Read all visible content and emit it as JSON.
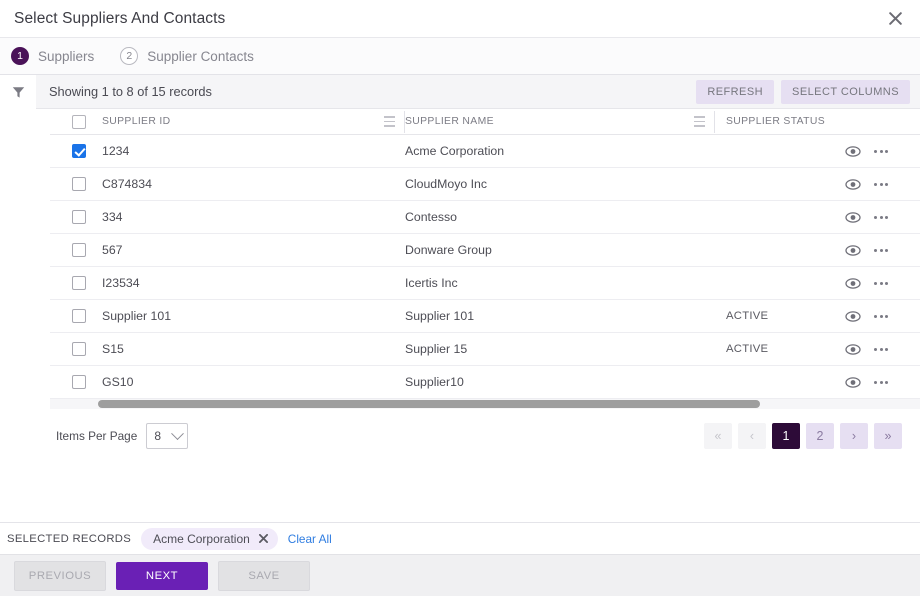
{
  "window": {
    "title": "Select Suppliers And Contacts",
    "close_icon": "close-icon"
  },
  "steps": [
    {
      "num": "1",
      "label": "Suppliers",
      "state": "active"
    },
    {
      "num": "2",
      "label": "Supplier Contacts",
      "state": "inactive"
    }
  ],
  "toolbar": {
    "filter_icon": "filter-icon",
    "showing_text": "Showing 1 to 8 of 15 records",
    "refresh_label": "REFRESH",
    "select_columns_label": "SELECT COLUMNS"
  },
  "table": {
    "columns": [
      "SUPPLIER ID",
      "SUPPLIER NAME",
      "SUPPLIER STATUS"
    ],
    "rows": [
      {
        "checked": true,
        "id": "1234",
        "name": "Acme Corporation",
        "status": ""
      },
      {
        "checked": false,
        "id": "C874834",
        "name": "CloudMoyo Inc",
        "status": ""
      },
      {
        "checked": false,
        "id": "334",
        "name": "Contesso",
        "status": ""
      },
      {
        "checked": false,
        "id": "567",
        "name": "Donware Group",
        "status": ""
      },
      {
        "checked": false,
        "id": "I23534",
        "name": "Icertis Inc",
        "status": ""
      },
      {
        "checked": false,
        "id": "Supplier 101",
        "name": "Supplier 101",
        "status": "ACTIVE"
      },
      {
        "checked": false,
        "id": "S15",
        "name": "Supplier 15",
        "status": "ACTIVE"
      },
      {
        "checked": false,
        "id": "GS10",
        "name": "Supplier10",
        "status": ""
      }
    ],
    "row_view_icon": "eye-icon",
    "row_more_icon": "more-options-icon"
  },
  "pagination": {
    "items_per_page_label": "Items Per Page",
    "items_per_page_value": "8",
    "first_label": "«",
    "prev_label": "‹",
    "next_label": "›",
    "last_label": "»",
    "pages": [
      "1",
      "2"
    ],
    "current_page": "1"
  },
  "selected_records": {
    "label": "SELECTED RECORDS",
    "chips": [
      "Acme Corporation"
    ],
    "clear_all_label": "Clear All"
  },
  "footer": {
    "previous_label": "PREVIOUS",
    "next_label": "NEXT",
    "save_label": "SAVE"
  },
  "colors": {
    "primary_purple": "#6a20b5",
    "step_active": "#4a1258",
    "page_active": "#2d0b38",
    "light_lavender": "#e6dff2",
    "checkbox_blue": "#1a73e8",
    "link_blue": "#2f7de1"
  }
}
